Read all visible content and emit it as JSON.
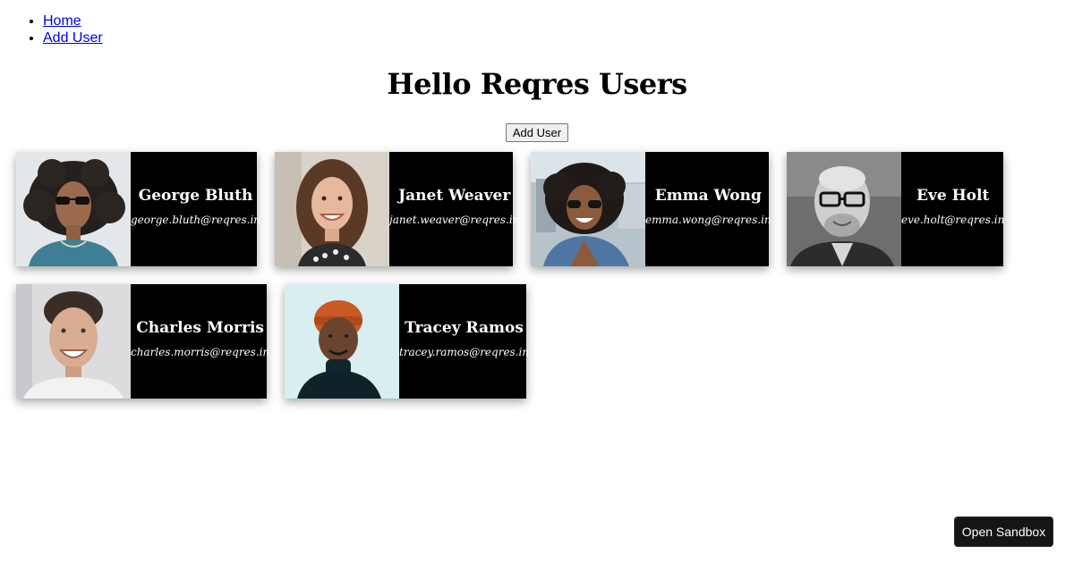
{
  "nav": {
    "items": [
      {
        "label": "Home"
      },
      {
        "label": "Add User"
      }
    ]
  },
  "page": {
    "title": "Hello Reqres Users",
    "add_button": "Add User"
  },
  "users": [
    {
      "name": "George Bluth",
      "email": "george.bluth@reqres.in"
    },
    {
      "name": "Janet Weaver",
      "email": "janet.weaver@reqres.in"
    },
    {
      "name": "Emma Wong",
      "email": "emma.wong@reqres.in"
    },
    {
      "name": "Eve Holt",
      "email": "eve.holt@reqres.in"
    },
    {
      "name": "Charles Morris",
      "email": "charles.morris@reqres.in"
    },
    {
      "name": "Tracey Ramos",
      "email": "tracey.ramos@reqres.in"
    }
  ],
  "sandbox_button": "Open Sandbox",
  "colors": {
    "card_background": "#000000",
    "card_text": "#ffffff",
    "link": "#0000ee"
  }
}
